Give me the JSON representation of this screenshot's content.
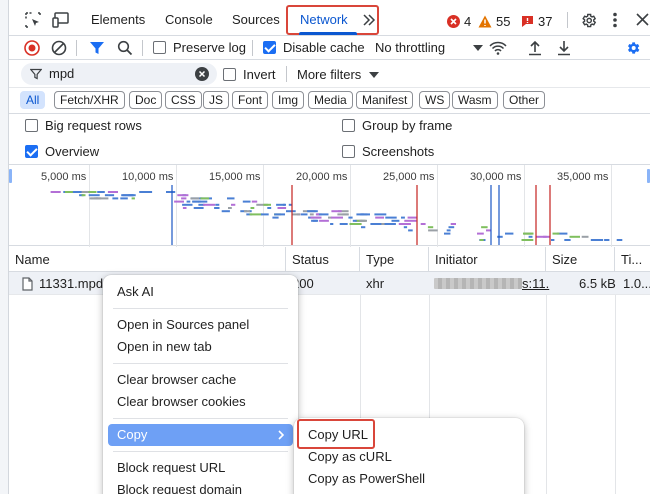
{
  "tabbar": {
    "tabs": [
      "Elements",
      "Console",
      "Sources",
      "Network"
    ],
    "active_tab": "Network",
    "more_tabs_icon": "chevron-double-right-icon",
    "errors_count": "4",
    "warnings_count": "55",
    "issues_count": "37"
  },
  "toolbar": {
    "preserve_log_label": "Preserve log",
    "preserve_log_checked": false,
    "disable_cache_label": "Disable cache",
    "disable_cache_checked": true,
    "throttling_value": "No throttling"
  },
  "filter": {
    "value": "mpd",
    "invert_label": "Invert",
    "more_filters_label": "More filters"
  },
  "type_filters": [
    "All",
    "Fetch/XHR",
    "Doc",
    "CSS",
    "JS",
    "Font",
    "Img",
    "Media",
    "Manifest",
    "WS",
    "Wasm",
    "Other"
  ],
  "options": {
    "big_request_rows": "Big request rows",
    "group_by_frame": "Group by frame",
    "overview": "Overview",
    "screenshots": "Screenshots"
  },
  "overview": {
    "ticks": [
      "5,000 ms",
      "10,000 ms",
      "15,000 ms",
      "20,000 ms",
      "25,000 ms",
      "30,000 ms",
      "35,000 ms"
    ]
  },
  "table": {
    "columns": [
      "Name",
      "Status",
      "Type",
      "Initiator",
      "Size",
      "Ti..."
    ],
    "rows": [
      {
        "name": "11331.mpd",
        "status": "200",
        "type": "xhr",
        "initiator_suffix": "s:11.",
        "size": "6.5 kB",
        "time": "1.0..."
      }
    ]
  },
  "context_menu": {
    "items": [
      "Ask AI",
      "Open in Sources panel",
      "Open in new tab",
      "Clear browser cache",
      "Clear browser cookies",
      "Copy",
      "Block request URL",
      "Block request domain"
    ],
    "highlighted": "Copy"
  },
  "copy_submenu": {
    "items": [
      "Copy URL",
      "Copy as cURL",
      "Copy as PowerShell"
    ]
  },
  "colors": {
    "accent": "#1b6ef3",
    "highlight_outline": "#d9463a",
    "error": "#d93025",
    "warning": "#e37400"
  }
}
